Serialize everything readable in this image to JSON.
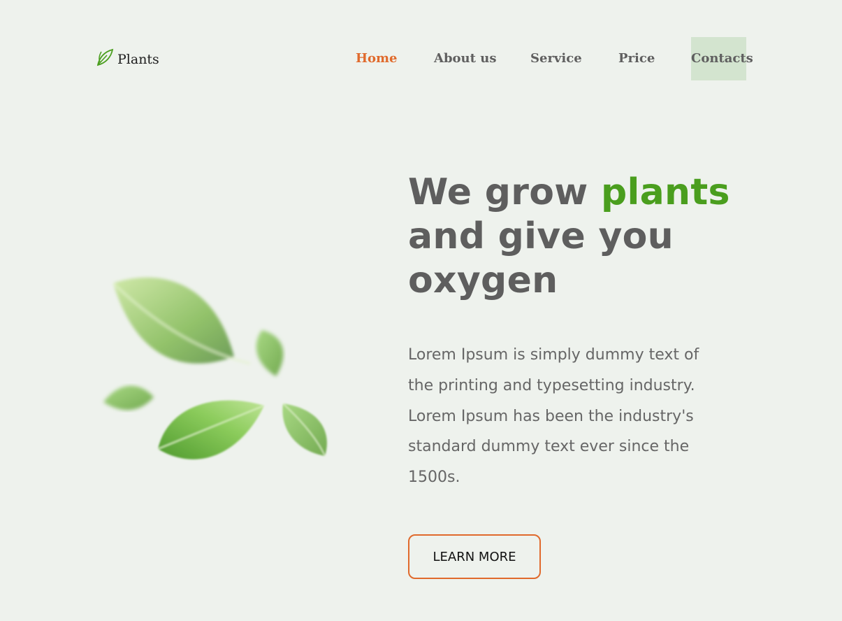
{
  "brand": {
    "name": "Plants",
    "icon": "leaf-icon"
  },
  "nav": {
    "items": [
      {
        "label": "Home",
        "state": "active"
      },
      {
        "label": "About us",
        "state": "normal"
      },
      {
        "label": "Service",
        "state": "normal"
      },
      {
        "label": "Price",
        "state": "normal"
      },
      {
        "label": "Contacts",
        "state": "hover"
      }
    ]
  },
  "hero": {
    "title_part1": "We grow ",
    "title_accent": "plants",
    "title_part2": "and give you oxygen",
    "body": "Lorem Ipsum is simply dummy text of the printing and typesetting industry. Lorem Ipsum has been the industry's standard dummy text ever since the 1500s.",
    "cta_label": "LEARN MORE",
    "illustration": "leaves-illustration"
  },
  "colors": {
    "background": "#eef2ed",
    "accent_green": "#4a9e1e",
    "accent_orange": "#e06a2c",
    "text_gray": "#5e5e5e",
    "hover_bg": "#d3e4cf"
  }
}
